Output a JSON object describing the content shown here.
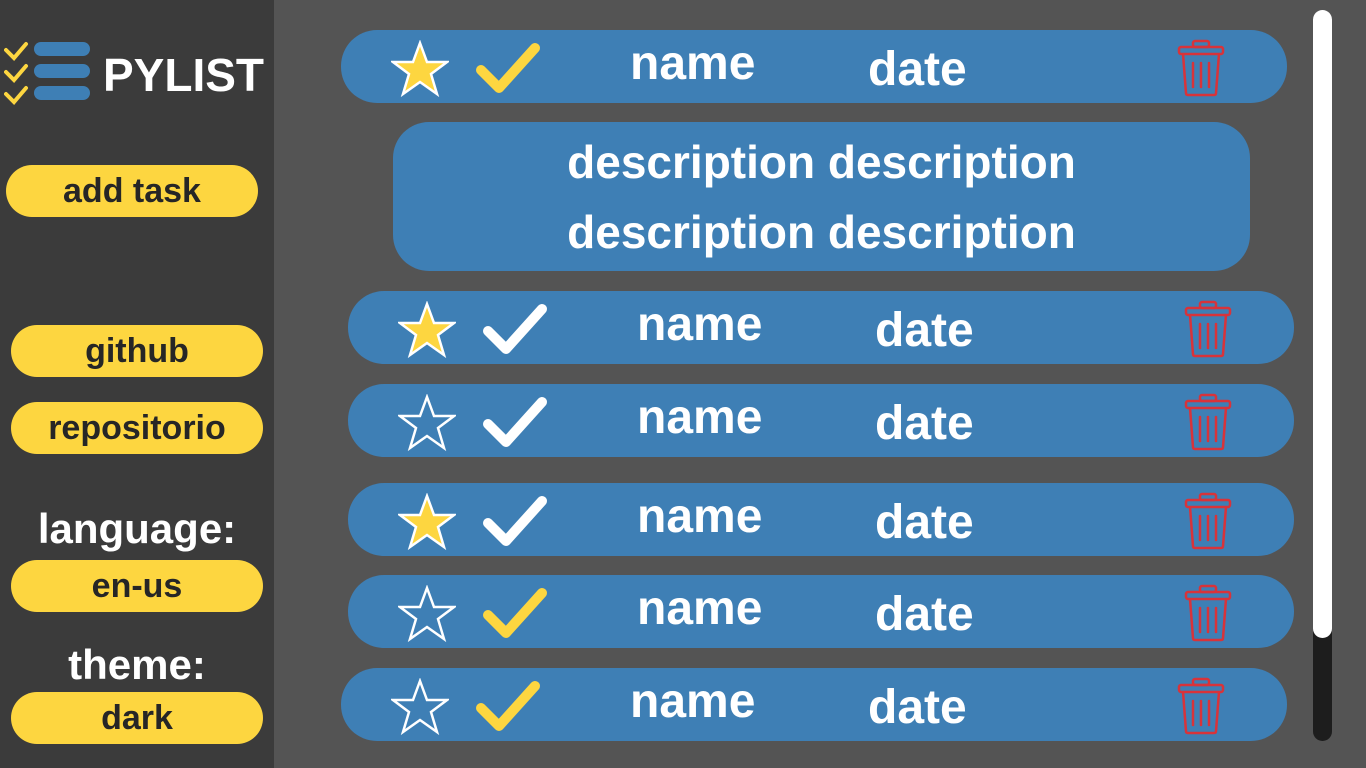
{
  "app": {
    "title": "PYLIST"
  },
  "sidebar": {
    "add_task": "add task",
    "github": "github",
    "repositorio": "repositorio",
    "language_label": "language:",
    "language_value": "en-us",
    "theme_label": "theme:",
    "theme_value": "dark"
  },
  "tasks": [
    {
      "favorite": true,
      "done": true,
      "name": "name",
      "date": "date",
      "check_color": "#fdd640"
    },
    {
      "favorite": true,
      "done": true,
      "name": "name",
      "date": "date",
      "check_color": "#ffffff"
    },
    {
      "favorite": false,
      "done": true,
      "name": "name",
      "date": "date",
      "check_color": "#ffffff"
    },
    {
      "favorite": true,
      "done": true,
      "name": "name",
      "date": "date",
      "check_color": "#ffffff"
    },
    {
      "favorite": false,
      "done": true,
      "name": "name",
      "date": "date",
      "check_color": "#fdd640"
    },
    {
      "favorite": false,
      "done": true,
      "name": "name",
      "date": "date",
      "check_color": "#fdd640"
    }
  ],
  "expanded_description": {
    "line1": "description description",
    "line2": "description description"
  },
  "colors": {
    "accent": "#fdd640",
    "task_bg": "#3e7fb5",
    "trash": "#d8333a",
    "sidebar_bg": "#3b3b3b",
    "main_bg": "#545454"
  },
  "icons": {
    "logo": "checklist-icon",
    "favorite": "star-icon",
    "complete": "checkmark-icon",
    "delete": "trash-icon"
  }
}
